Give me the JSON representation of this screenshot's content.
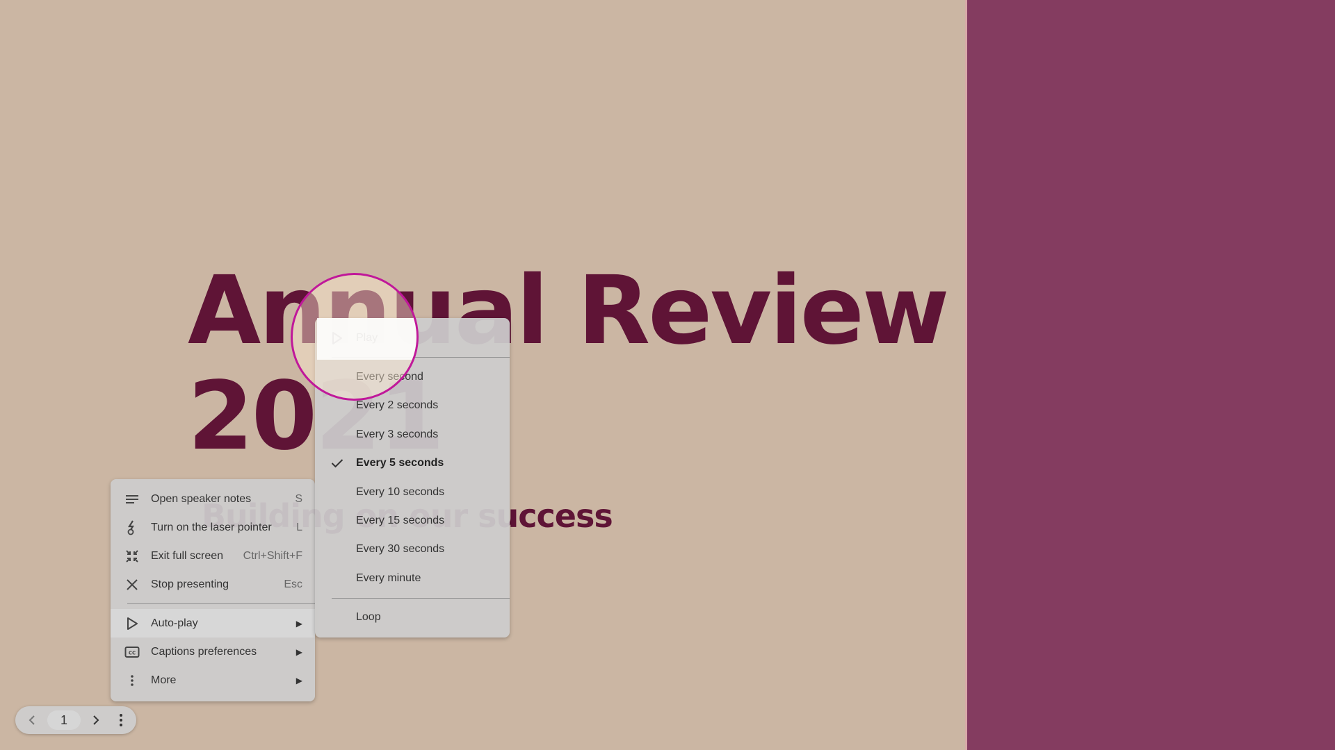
{
  "slide": {
    "title_line1": "Annual Review",
    "title_line2": "2021",
    "subtitle": "Building on our success",
    "colors": {
      "background": "#cbb6a3",
      "accent_panel": "#843c60",
      "title": "#5f1436"
    }
  },
  "main_menu": {
    "items": [
      {
        "label": "Open speaker notes",
        "shortcut": "S",
        "icon": "speaker-notes-icon"
      },
      {
        "label": "Turn on the laser pointer",
        "shortcut": "L",
        "icon": "laser-pointer-icon"
      },
      {
        "label": "Exit full screen",
        "shortcut": "Ctrl+Shift+F",
        "icon": "exit-fullscreen-icon"
      },
      {
        "label": "Stop presenting",
        "shortcut": "Esc",
        "icon": "close-icon"
      },
      {
        "label": "Auto-play",
        "submenu": true,
        "icon": "play-icon",
        "highlighted": true
      },
      {
        "label": "Captions preferences",
        "submenu": true,
        "icon": "captions-icon"
      },
      {
        "label": "More",
        "submenu": true,
        "icon": "more-vert-icon"
      }
    ]
  },
  "autoplay_menu": {
    "play_label": "Play",
    "intervals": [
      {
        "label": "Every second",
        "selected": false
      },
      {
        "label": "Every 2 seconds",
        "selected": false
      },
      {
        "label": "Every 3 seconds",
        "selected": false
      },
      {
        "label": "Every 5 seconds",
        "selected": true
      },
      {
        "label": "Every 10 seconds",
        "selected": false
      },
      {
        "label": "Every 15 seconds",
        "selected": false
      },
      {
        "label": "Every 30 seconds",
        "selected": false
      },
      {
        "label": "Every minute",
        "selected": false
      }
    ],
    "loop_label": "Loop"
  },
  "toolbar": {
    "page_number": "1"
  },
  "magnifier": {
    "border_color": "#c0189a"
  }
}
